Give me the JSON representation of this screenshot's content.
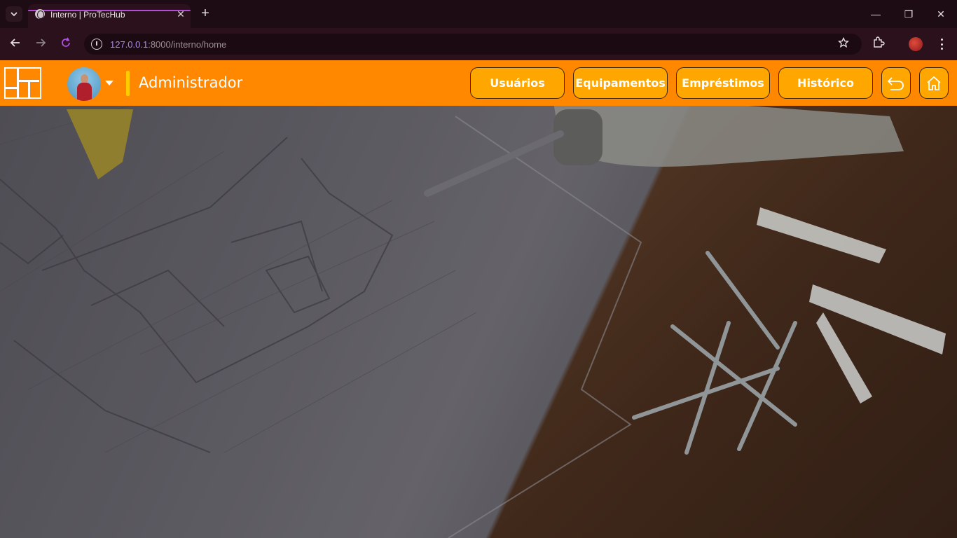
{
  "browser": {
    "tab_title": "Interno | ProTecHub",
    "tab_close": "✕",
    "new_tab": "+",
    "url_host": "127.0.0.1",
    "url_path": ":8000/interno/home",
    "window_controls": {
      "minimize": "—",
      "maximize": "❐",
      "close": "✕"
    }
  },
  "header": {
    "role_label": "Administrador",
    "nav": [
      {
        "label": "Usuários"
      },
      {
        "label": "Equipamentos"
      },
      {
        "label": "Empréstimos"
      },
      {
        "label": "Histórico"
      }
    ],
    "icons": {
      "back": "undo-icon",
      "home": "home-icon"
    }
  },
  "colors": {
    "header_bg": "#ff8800",
    "button_bg": "#ffa600",
    "divider": "#ffcc00"
  }
}
